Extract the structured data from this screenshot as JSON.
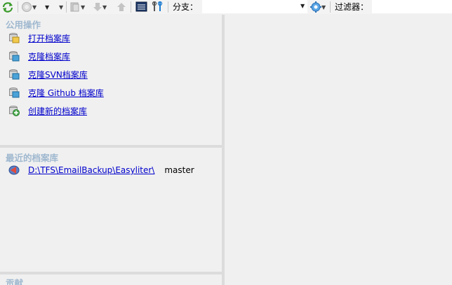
{
  "toolbar": {
    "branch_label": "分支：",
    "branch_value": "",
    "filter_label": "过滤器：",
    "filter_value": ""
  },
  "common_actions": {
    "title": "公用操作",
    "items": [
      {
        "label": "打开档案库",
        "icon": "open-repo-icon"
      },
      {
        "label": "克隆档案库",
        "icon": "clone-repo-icon"
      },
      {
        "label": "克隆SVN档案库",
        "icon": "clone-svn-icon"
      },
      {
        "label": "克隆 Github 档案库",
        "icon": "clone-github-icon"
      },
      {
        "label": "创建新的档案库",
        "icon": "create-repo-icon"
      }
    ]
  },
  "recent": {
    "title": "最近的档案库",
    "items": [
      {
        "path": "D:\\TFS\\EmailBackup\\Easyliter\\",
        "branch": "master"
      }
    ]
  },
  "contribute": {
    "title": "贡献"
  },
  "colors": {
    "section_title": "#9fb8cf",
    "link": "#0000cc",
    "background": "#f0f0f0"
  }
}
